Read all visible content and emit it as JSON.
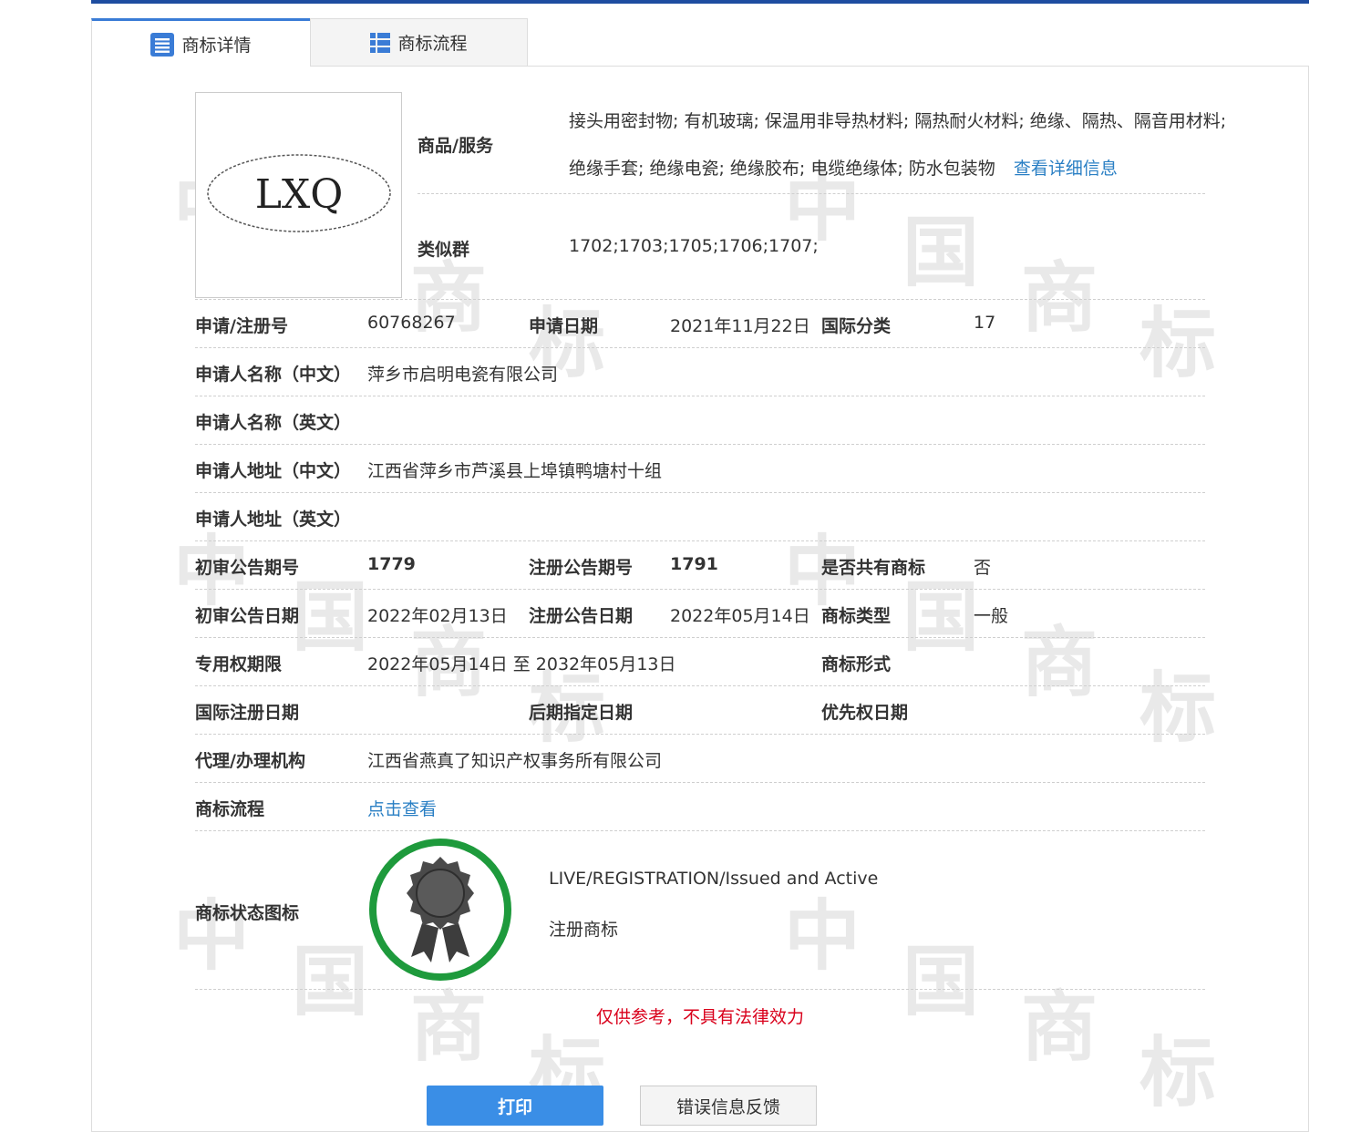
{
  "tabs": {
    "details": "商标详情",
    "process": "商标流程"
  },
  "trademark_image_text": "LXQ",
  "fields": {
    "goods_label": "商品/服务",
    "goods_line1": "接头用密封物; 有机玻璃; 保温用非导热材料; 隔热耐火材料; 绝缘、隔热、隔音用材料;",
    "goods_line2": "绝缘手套; 绝缘电瓷; 绝缘胶布; 电缆绝缘体; 防水包装物",
    "goods_more_link": "查看详细信息",
    "similar_group_label": "类似群",
    "similar_group_value": "1702;1703;1705;1706;1707;",
    "reg_no_label": "申请/注册号",
    "reg_no_value": "60768267",
    "apply_date_label": "申请日期",
    "apply_date_value": "2021年11月22日",
    "intl_class_label": "国际分类",
    "intl_class_value": "17",
    "applicant_cn_label": "申请人名称（中文）",
    "applicant_cn_value": "萍乡市启明电瓷有限公司",
    "applicant_en_label": "申请人名称（英文）",
    "address_cn_label": "申请人地址（中文）",
    "address_cn_value": "江西省萍乡市芦溪县上埠镇鸭塘村十组",
    "address_en_label": "申请人地址（英文）",
    "prelim_issue_label": "初审公告期号",
    "prelim_issue_value": "1779",
    "reg_issue_label": "注册公告期号",
    "reg_issue_value": "1791",
    "shared_label": "是否共有商标",
    "shared_value": "否",
    "prelim_date_label": "初审公告日期",
    "prelim_date_value": "2022年02月13日",
    "reg_date_label": "注册公告日期",
    "reg_date_value": "2022年05月14日",
    "tm_type_label": "商标类型",
    "tm_type_value": "一般",
    "term_label": "专用权期限",
    "term_value": "2022年05月14日 至 2032年05月13日",
    "tm_form_label": "商标形式",
    "intl_reg_date_label": "国际注册日期",
    "later_designation_label": "后期指定日期",
    "priority_date_label": "优先权日期",
    "agency_label": "代理/办理机构",
    "agency_value": "江西省燕真了知识产权事务所有限公司",
    "process_label": "商标流程",
    "process_link": "点击查看",
    "status_label": "商标状态图标",
    "status_en": "LIVE/REGISTRATION/Issued and Active",
    "status_cn": "注册商标"
  },
  "notice": "仅供参考，不具有法律效力",
  "buttons": {
    "print": "打印",
    "feedback": "错误信息反馈"
  },
  "colors": {
    "accent_bar": "#1e4da0",
    "link": "#2a7fc4",
    "notice": "#d9001b",
    "print_button": "#3a8ee6",
    "status_ring": "#1e9a3c"
  }
}
